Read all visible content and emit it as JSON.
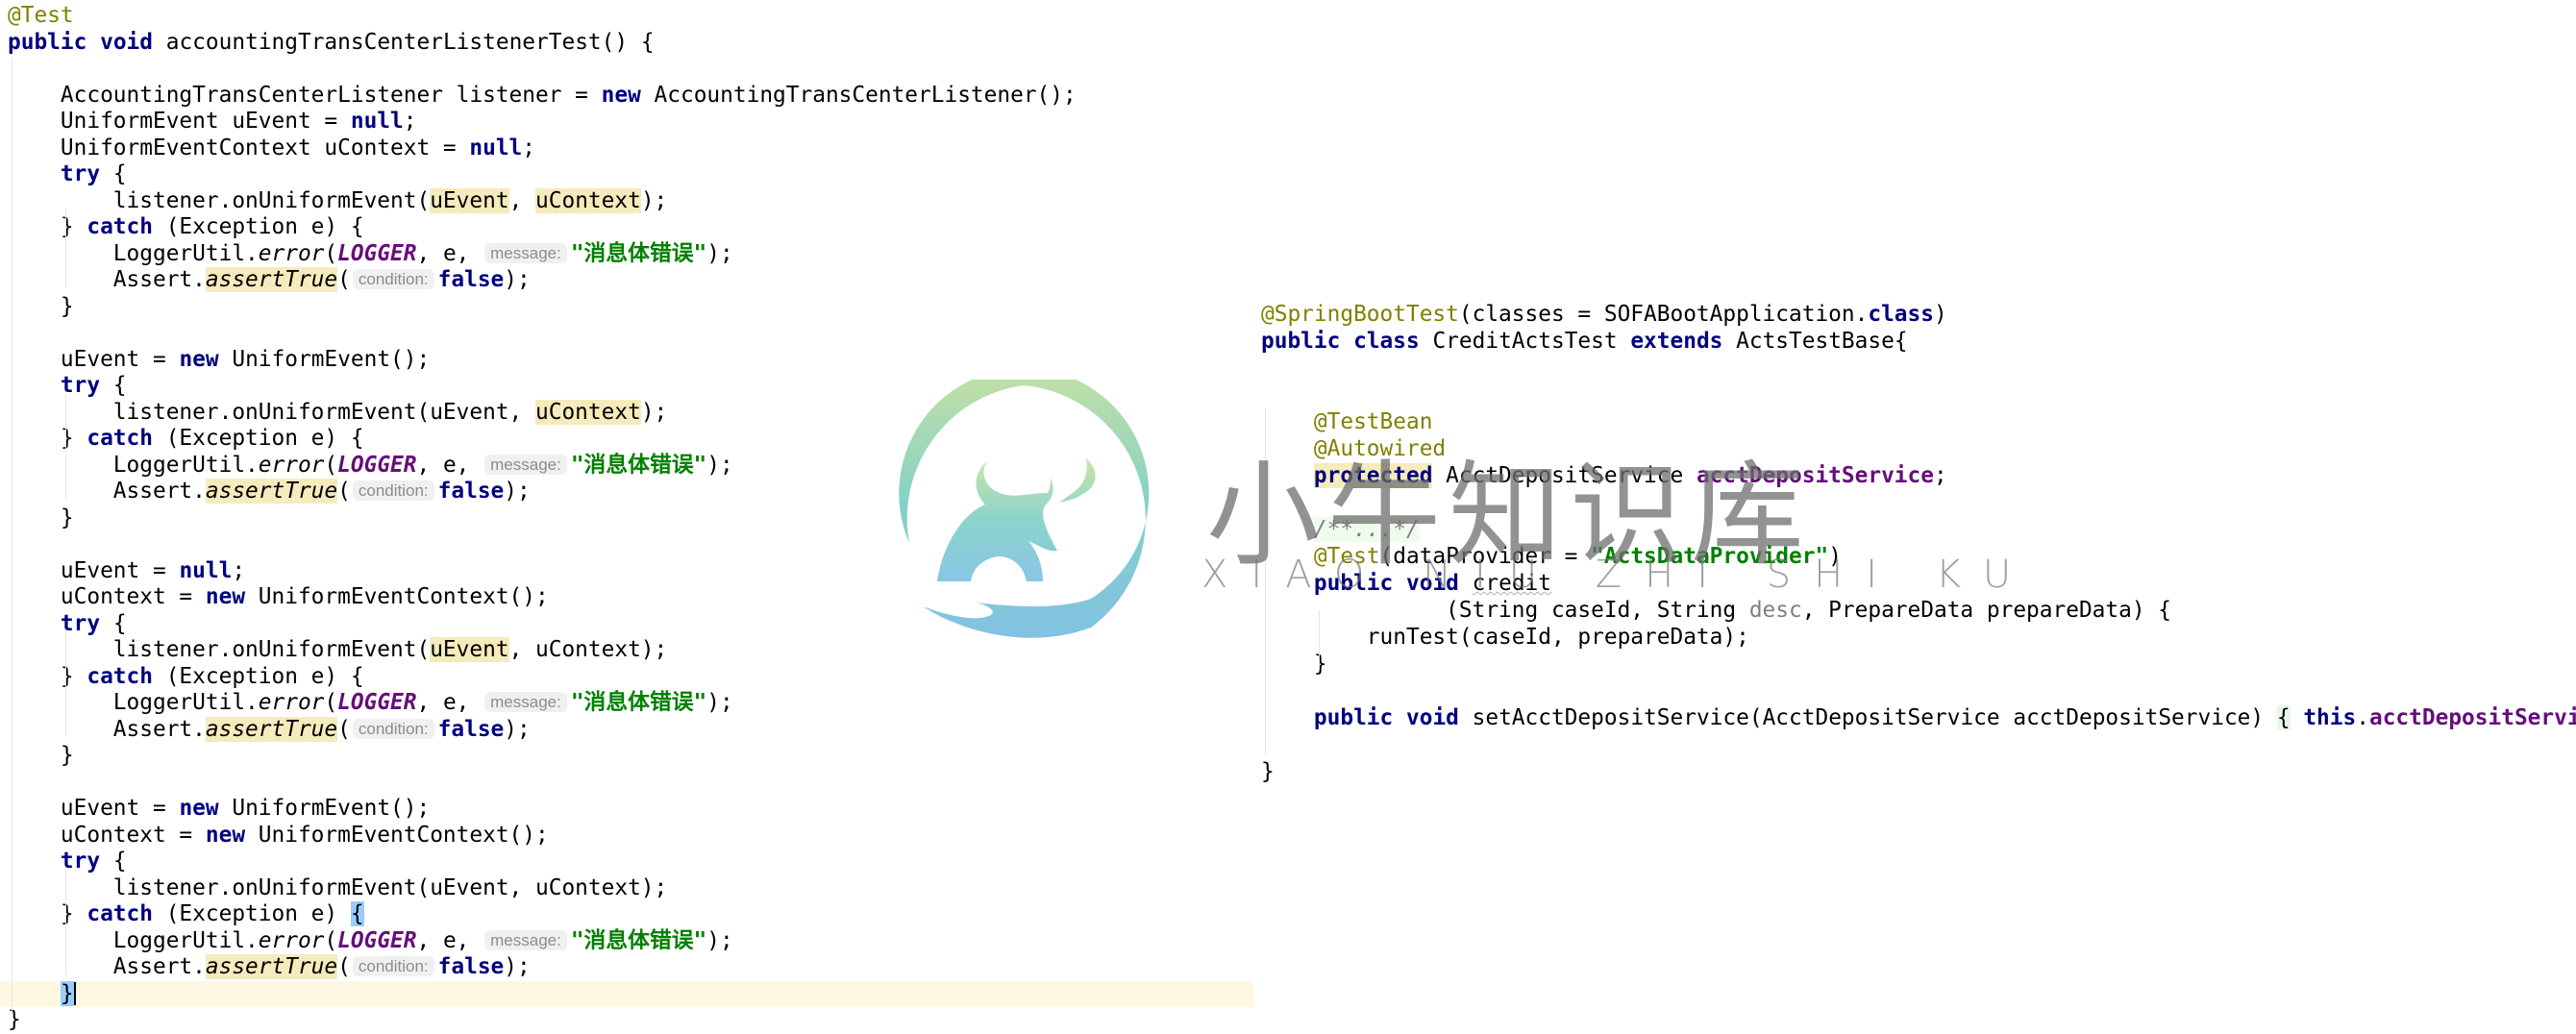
{
  "left_editor": {
    "caret_line": 37,
    "lines": [
      [
        {
          "t": "@Test",
          "c": "ann"
        }
      ],
      [
        {
          "t": "public",
          "c": "kw"
        },
        {
          "t": " "
        },
        {
          "t": "void",
          "c": "kw"
        },
        {
          "t": " accountingTransCenterListenerTest() {"
        }
      ],
      [],
      [
        {
          "t": "    AccountingTransCenterListener listener = "
        },
        {
          "t": "new",
          "c": "kw"
        },
        {
          "t": " AccountingTransCenterListener();"
        }
      ],
      [
        {
          "t": "    UniformEvent uEvent = "
        },
        {
          "t": "null",
          "c": "kw"
        },
        {
          "t": ";"
        }
      ],
      [
        {
          "t": "    UniformEventContext uContext = "
        },
        {
          "t": "null",
          "c": "kw"
        },
        {
          "t": ";"
        }
      ],
      [
        {
          "t": "    "
        },
        {
          "t": "try",
          "c": "kw"
        },
        {
          "t": " {"
        }
      ],
      [
        {
          "t": "        listener.onUniformEvent("
        },
        {
          "t": "uEvent",
          "c": "hl"
        },
        {
          "t": ", "
        },
        {
          "t": "uContext",
          "c": "hl"
        },
        {
          "t": ");"
        }
      ],
      [
        {
          "t": "    } "
        },
        {
          "t": "catch",
          "c": "kw"
        },
        {
          "t": " (Exception e) {"
        }
      ],
      [
        {
          "t": "        LoggerUtil."
        },
        {
          "t": "error",
          "c": "static-method"
        },
        {
          "t": "("
        },
        {
          "t": "LOGGER",
          "c": "static-field"
        },
        {
          "t": ", e, "
        },
        {
          "t": "message:",
          "c": "hint"
        },
        {
          "t": "\"消息体错误\"",
          "c": "str"
        },
        {
          "t": ");"
        }
      ],
      [
        {
          "t": "        Assert."
        },
        {
          "t": "assertTrue",
          "c": "static-method hl"
        },
        {
          "t": "("
        },
        {
          "t": "condition:",
          "c": "hint"
        },
        {
          "t": "false",
          "c": "kw"
        },
        {
          "t": ");"
        }
      ],
      [
        {
          "t": "    }"
        }
      ],
      [],
      [
        {
          "t": "    uEvent = "
        },
        {
          "t": "new",
          "c": "kw"
        },
        {
          "t": " UniformEvent();"
        }
      ],
      [
        {
          "t": "    "
        },
        {
          "t": "try",
          "c": "kw"
        },
        {
          "t": " {"
        }
      ],
      [
        {
          "t": "        listener.onUniformEvent(uEvent, "
        },
        {
          "t": "uContext",
          "c": "hl"
        },
        {
          "t": ");"
        }
      ],
      [
        {
          "t": "    } "
        },
        {
          "t": "catch",
          "c": "kw"
        },
        {
          "t": " (Exception e) {"
        }
      ],
      [
        {
          "t": "        LoggerUtil."
        },
        {
          "t": "error",
          "c": "static-method"
        },
        {
          "t": "("
        },
        {
          "t": "LOGGER",
          "c": "static-field"
        },
        {
          "t": ", e, "
        },
        {
          "t": "message:",
          "c": "hint"
        },
        {
          "t": "\"消息体错误\"",
          "c": "str"
        },
        {
          "t": ");"
        }
      ],
      [
        {
          "t": "        Assert."
        },
        {
          "t": "assertTrue",
          "c": "static-method hl"
        },
        {
          "t": "("
        },
        {
          "t": "condition:",
          "c": "hint"
        },
        {
          "t": "false",
          "c": "kw"
        },
        {
          "t": ");"
        }
      ],
      [
        {
          "t": "    }"
        }
      ],
      [],
      [
        {
          "t": "    uEvent = "
        },
        {
          "t": "null",
          "c": "kw"
        },
        {
          "t": ";"
        }
      ],
      [
        {
          "t": "    uContext = "
        },
        {
          "t": "new",
          "c": "kw"
        },
        {
          "t": " UniformEventContext();"
        }
      ],
      [
        {
          "t": "    "
        },
        {
          "t": "try",
          "c": "kw"
        },
        {
          "t": " {"
        }
      ],
      [
        {
          "t": "        listener.onUniformEvent("
        },
        {
          "t": "uEvent",
          "c": "hl"
        },
        {
          "t": ", uContext);"
        }
      ],
      [
        {
          "t": "    } "
        },
        {
          "t": "catch",
          "c": "kw"
        },
        {
          "t": " (Exception e) {"
        }
      ],
      [
        {
          "t": "        LoggerUtil."
        },
        {
          "t": "error",
          "c": "static-method"
        },
        {
          "t": "("
        },
        {
          "t": "LOGGER",
          "c": "static-field"
        },
        {
          "t": ", e, "
        },
        {
          "t": "message:",
          "c": "hint"
        },
        {
          "t": "\"消息体错误\"",
          "c": "str"
        },
        {
          "t": ");"
        }
      ],
      [
        {
          "t": "        Assert."
        },
        {
          "t": "assertTrue",
          "c": "static-method hl"
        },
        {
          "t": "("
        },
        {
          "t": "condition:",
          "c": "hint"
        },
        {
          "t": "false",
          "c": "kw"
        },
        {
          "t": ");"
        }
      ],
      [
        {
          "t": "    }"
        }
      ],
      [],
      [
        {
          "t": "    uEvent = "
        },
        {
          "t": "new",
          "c": "kw"
        },
        {
          "t": " UniformEvent();"
        }
      ],
      [
        {
          "t": "    uContext = "
        },
        {
          "t": "new",
          "c": "kw"
        },
        {
          "t": " UniformEventContext();"
        }
      ],
      [
        {
          "t": "    "
        },
        {
          "t": "try",
          "c": "kw"
        },
        {
          "t": " {"
        }
      ],
      [
        {
          "t": "        listener.onUniformEvent(uEvent, uContext);"
        }
      ],
      [
        {
          "t": "    } "
        },
        {
          "t": "catch",
          "c": "kw"
        },
        {
          "t": " (Exception e) "
        },
        {
          "t": "{",
          "c": "brace-match"
        }
      ],
      [
        {
          "t": "        LoggerUtil."
        },
        {
          "t": "error",
          "c": "static-method"
        },
        {
          "t": "("
        },
        {
          "t": "LOGGER",
          "c": "static-field"
        },
        {
          "t": ", e, "
        },
        {
          "t": "message:",
          "c": "hint"
        },
        {
          "t": "\"消息体错误\"",
          "c": "str"
        },
        {
          "t": ");"
        }
      ],
      [
        {
          "t": "        Assert."
        },
        {
          "t": "assertTrue",
          "c": "static-method hl"
        },
        {
          "t": "("
        },
        {
          "t": "condition:",
          "c": "hint"
        },
        {
          "t": "false",
          "c": "kw"
        },
        {
          "t": ");"
        }
      ],
      [
        {
          "t": "    "
        },
        {
          "t": "}",
          "c": "brace-match"
        },
        {
          "t": "",
          "c": "caret"
        }
      ],
      [
        {
          "t": "}"
        }
      ]
    ]
  },
  "right_editor": {
    "lines": [
      [
        {
          "t": "@SpringBootTest",
          "c": "ann"
        },
        {
          "t": "(classes = SOFABootApplication."
        },
        {
          "t": "class",
          "c": "kw"
        },
        {
          "t": ")"
        }
      ],
      [
        {
          "t": "public",
          "c": "kw"
        },
        {
          "t": " "
        },
        {
          "t": "class",
          "c": "kw"
        },
        {
          "t": " CreditActsTest "
        },
        {
          "t": "extends",
          "c": "kw"
        },
        {
          "t": " ActsTestBase{"
        }
      ],
      [],
      [],
      [
        {
          "t": "    "
        },
        {
          "t": "@TestBean",
          "c": "ann"
        }
      ],
      [
        {
          "t": "    "
        },
        {
          "t": "@Autowired",
          "c": "ann"
        }
      ],
      [
        {
          "t": "    "
        },
        {
          "t": "protected",
          "c": "kw hl"
        },
        {
          "t": " AcctDepositService "
        },
        {
          "t": "acctDepositService",
          "c": "field"
        },
        {
          "t": ";"
        }
      ],
      [],
      [
        {
          "t": "    "
        },
        {
          "t": "/**...*/",
          "c": "comment"
        }
      ],
      [
        {
          "t": "    "
        },
        {
          "t": "@Test",
          "c": "ann"
        },
        {
          "t": "(dataProvider = "
        },
        {
          "t": "\"ActsDataProvider\"",
          "c": "str"
        },
        {
          "t": ")"
        }
      ],
      [
        {
          "t": "    "
        },
        {
          "t": "public",
          "c": "kw"
        },
        {
          "t": " "
        },
        {
          "t": "void",
          "c": "kw"
        },
        {
          "t": " "
        },
        {
          "t": "credit",
          "c": "warn"
        }
      ],
      [
        {
          "t": "              (String caseId, String "
        },
        {
          "t": "desc",
          "c": "unused"
        },
        {
          "t": ", PrepareData prepareData) {"
        }
      ],
      [
        {
          "t": "        runTest(caseId, prepareData);"
        }
      ],
      [
        {
          "t": "    }"
        }
      ],
      [],
      [
        {
          "t": "    "
        },
        {
          "t": "public",
          "c": "kw"
        },
        {
          "t": " "
        },
        {
          "t": "void",
          "c": "kw"
        },
        {
          "t": " setAcctDepositService(AcctDepositService acctDepositService) "
        },
        {
          "t": "{",
          "c": "fold-bg"
        },
        {
          "t": " "
        },
        {
          "t": "this",
          "c": "kw"
        },
        {
          "t": "."
        },
        {
          "t": "acctDepositService",
          "c": "field"
        }
      ],
      [],
      [
        {
          "t": "}"
        }
      ]
    ]
  },
  "watermark": {
    "brand_cn": "小牛知识库",
    "brand_en": "XIAO NIU ZHI SHI KU",
    "logo_icon": "bull-in-hand-logo-icon",
    "gradient_top": "#c2e0a0",
    "gradient_bottom": "#7cbfe2"
  },
  "colors": {
    "keyword": "#000080",
    "annotation": "#808000",
    "string": "#008000",
    "field": "#660e7a",
    "usage_highlight": "#f6ebbc",
    "caret_row": "#fef8e3",
    "brace_match": "#99ccff"
  }
}
